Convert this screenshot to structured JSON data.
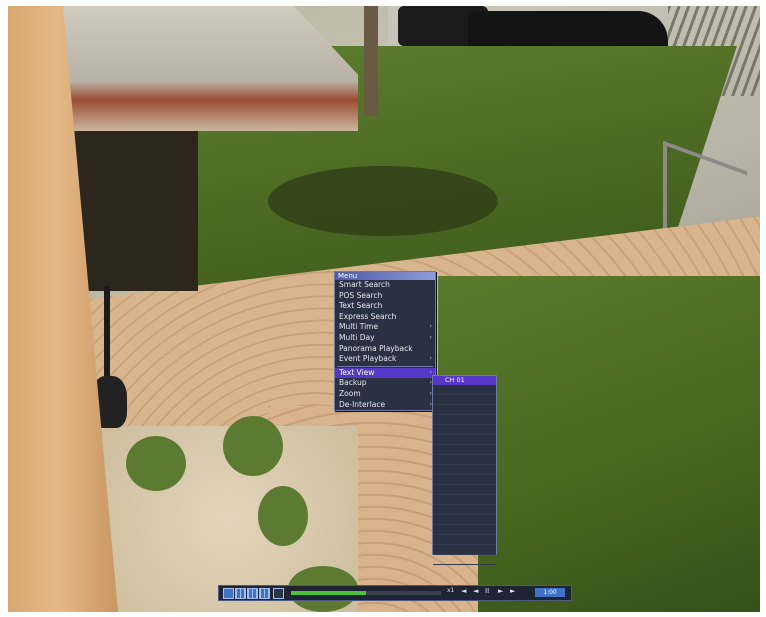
{
  "camera_view": {
    "description_icon": "camera-feed"
  },
  "menu": {
    "title": "Menu",
    "items": [
      {
        "label": "Smart Search",
        "has_submenu": false
      },
      {
        "label": "POS Search",
        "has_submenu": false
      },
      {
        "label": "Text Search",
        "has_submenu": false
      },
      {
        "label": "Express Search",
        "has_submenu": false
      },
      {
        "label": "Multi Time",
        "has_submenu": true
      },
      {
        "label": "Multi Day",
        "has_submenu": true
      },
      {
        "label": "Panorama Playback",
        "has_submenu": false
      },
      {
        "label": "Event Playback",
        "has_submenu": true
      },
      {
        "label": "Text View",
        "has_submenu": true,
        "active": true
      },
      {
        "label": "Backup",
        "has_submenu": true
      },
      {
        "label": "Zoom",
        "has_submenu": true
      },
      {
        "label": "De-Interlace",
        "has_submenu": true
      }
    ],
    "arrow": "›"
  },
  "submenu": {
    "selected": "CH 01"
  },
  "toolbar": {
    "progress": 0.5,
    "speed": "x1",
    "controls": [
      "◄",
      "◄",
      "II",
      "►",
      "►"
    ],
    "time": "1:00"
  },
  "colors": {
    "menu_bg": "#2a3142",
    "highlight": "#5538c6",
    "progress_fill": "#4cc23a",
    "toolbar_button": "#3f73c7"
  }
}
